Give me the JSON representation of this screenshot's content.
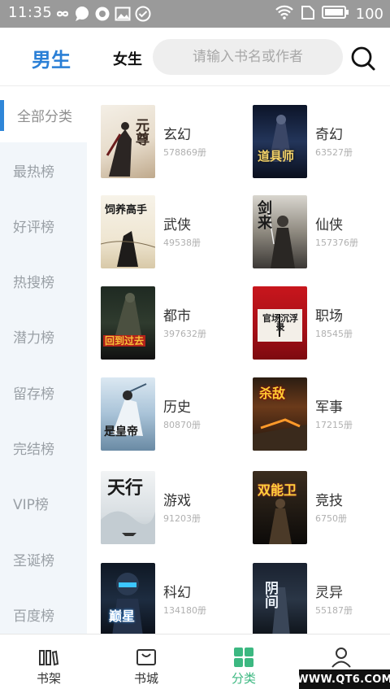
{
  "status_bar": {
    "time": "11:35",
    "icons": [
      "infinity-icon",
      "chat-bubble-icon",
      "circle-badge-icon",
      "image-icon",
      "check-circle-icon"
    ],
    "battery": "100"
  },
  "header": {
    "tab_male": "男生",
    "tab_female": "女生",
    "search_placeholder": "请输入书名或作者",
    "accent_color": "#2a7fd6"
  },
  "sidebar": {
    "items": [
      {
        "label": "全部分类",
        "active": true
      },
      {
        "label": "最热榜"
      },
      {
        "label": "好评榜"
      },
      {
        "label": "热搜榜"
      },
      {
        "label": "潜力榜"
      },
      {
        "label": "留存榜"
      },
      {
        "label": "完结榜"
      },
      {
        "label": "VIP榜"
      },
      {
        "label": "圣诞榜"
      },
      {
        "label": "百度榜"
      }
    ]
  },
  "categories": [
    {
      "name": "玄幻",
      "count": "578869册",
      "cover_text": "元尊"
    },
    {
      "name": "奇幻",
      "count": "63527册",
      "cover_text": "道具师"
    },
    {
      "name": "武侠",
      "count": "49538册",
      "cover_text": "饲养高手"
    },
    {
      "name": "仙侠",
      "count": "157376册",
      "cover_text": "剑来"
    },
    {
      "name": "都市",
      "count": "397632册",
      "cover_text": "回到过去"
    },
    {
      "name": "职场",
      "count": "18545册",
      "cover_text": "官场沉浮录"
    },
    {
      "name": "历史",
      "count": "80870册",
      "cover_text": "是皇帝"
    },
    {
      "name": "军事",
      "count": "17215册",
      "cover_text": "杀敌"
    },
    {
      "name": "游戏",
      "count": "91203册",
      "cover_text": "天行"
    },
    {
      "name": "竞技",
      "count": "6750册",
      "cover_text": "双能卫"
    },
    {
      "name": "科幻",
      "count": "134180册",
      "cover_text": "巅星"
    },
    {
      "name": "灵异",
      "count": "55187册",
      "cover_text": "阴间"
    }
  ],
  "bottom_nav": {
    "items": [
      {
        "label": "书架",
        "icon": "bookshelf-icon"
      },
      {
        "label": "书城",
        "icon": "store-bag-icon"
      },
      {
        "label": "分类",
        "icon": "grid-category-icon",
        "active": true
      },
      {
        "label": "",
        "icon": "profile-icon"
      }
    ],
    "active_color": "#3cb881"
  },
  "watermark": "WWW.QT6.COM"
}
